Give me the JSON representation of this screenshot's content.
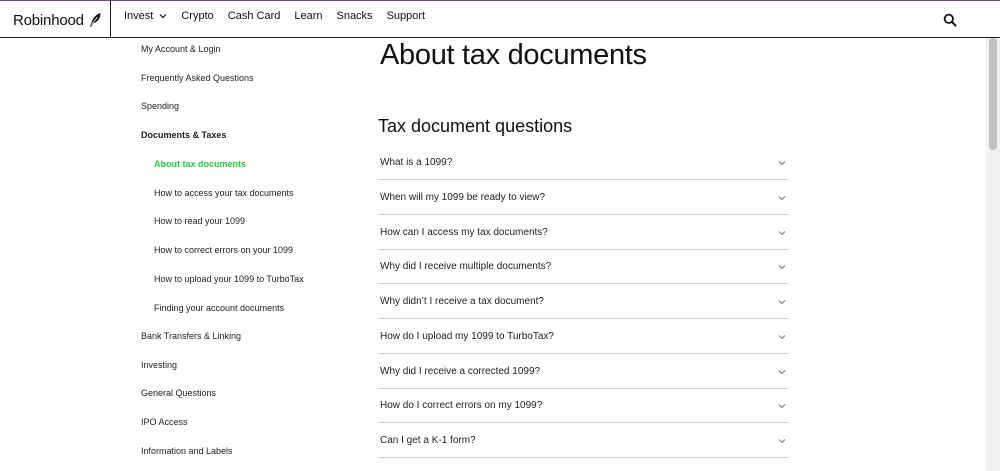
{
  "header": {
    "brand": "Robinhood",
    "nav": [
      "Invest",
      "Crypto",
      "Cash Card",
      "Learn",
      "Snacks",
      "Support"
    ]
  },
  "sidebar": {
    "items": [
      {
        "label": "My Account & Login",
        "level": 0,
        "style": "normal"
      },
      {
        "label": "Frequently Asked Questions",
        "level": 0,
        "style": "normal"
      },
      {
        "label": "Spending",
        "level": 0,
        "style": "normal"
      },
      {
        "label": "Documents & Taxes",
        "level": 0,
        "style": "bold"
      },
      {
        "label": "About tax documents",
        "level": 1,
        "style": "active"
      },
      {
        "label": "How to access your tax documents",
        "level": 1,
        "style": "normal"
      },
      {
        "label": "How to read your 1099",
        "level": 1,
        "style": "normal"
      },
      {
        "label": "How to correct errors on your 1099",
        "level": 1,
        "style": "normal"
      },
      {
        "label": "How to upload your 1099 to TurboTax",
        "level": 1,
        "style": "normal"
      },
      {
        "label": "Finding your account documents",
        "level": 1,
        "style": "normal"
      },
      {
        "label": "Bank Transfers & Linking",
        "level": 0,
        "style": "normal"
      },
      {
        "label": "Investing",
        "level": 0,
        "style": "normal"
      },
      {
        "label": "General Questions",
        "level": 0,
        "style": "normal"
      },
      {
        "label": "IPO Access",
        "level": 0,
        "style": "normal"
      },
      {
        "label": "Information and Labels",
        "level": 0,
        "style": "normal"
      }
    ]
  },
  "main": {
    "title": "About tax documents",
    "section_title": "Tax document questions",
    "questions": [
      "What is a 1099?",
      "When will my 1099 be ready to view?",
      "How can I access my tax documents?",
      "Why did I receive multiple documents?",
      "Why didn’t I receive a tax document?",
      "How do I upload my 1099 to TurboTax?",
      "Why did I receive a corrected 1099?",
      "How do I correct errors on my 1099?",
      "Can I get a K-1 form?"
    ]
  },
  "colors": {
    "accent": "#21ce39",
    "text": "#111111",
    "divider": "#cfcfcf"
  },
  "icons": {
    "brand": "feather-icon",
    "search": "search-icon",
    "dropdown": "chevron-down-icon"
  }
}
